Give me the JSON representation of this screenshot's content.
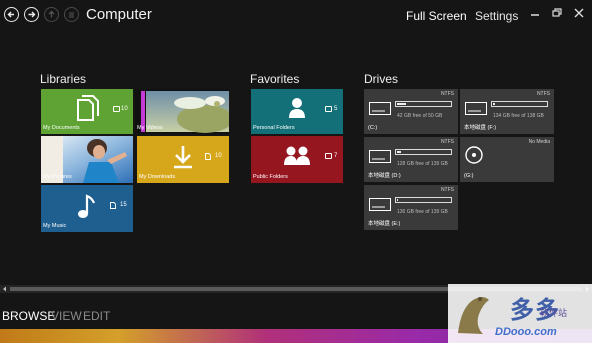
{
  "header": {
    "title": "Computer",
    "menu": [
      "Full Screen",
      "Settings"
    ]
  },
  "libraries": {
    "title": "Libraries",
    "tiles": [
      {
        "label": "My Documents",
        "count": "10",
        "color": "#5ea334",
        "icon": "documents-icon"
      },
      {
        "label": "My Videos",
        "icon": "video-thumbnail"
      },
      {
        "label": "My Pictures",
        "icon": "picture-thumbnail"
      },
      {
        "label": "My Downloads",
        "count": "10",
        "color": "#d6a71b",
        "icon": "download-icon"
      },
      {
        "label": "My Music",
        "count": "15",
        "color": "#1f5f8f",
        "icon": "music-note-icon"
      }
    ]
  },
  "favorites": {
    "title": "Favorites",
    "tiles": [
      {
        "label": "Personal Folders",
        "count": "5",
        "color": "#147078",
        "icon": "person-icon"
      },
      {
        "label": "Public Folders",
        "count": "7",
        "color": "#961620",
        "icon": "people-icon"
      }
    ]
  },
  "drives": {
    "title": "Drives",
    "items": [
      {
        "name": "(C:)",
        "fs": "NTFS",
        "usage": "42 GB free of 50 GB",
        "used_fraction": 0.16,
        "icon": "hard-drive-icon"
      },
      {
        "name": "本地磁盘 (F:)",
        "fs": "NTFS",
        "usage": "134 GB free of 138 GB",
        "used_fraction": 0.03,
        "icon": "hard-drive-icon"
      },
      {
        "name": "本地磁盘 (D:)",
        "fs": "NTFS",
        "usage": "128 GB free of 139 GB",
        "used_fraction": 0.08,
        "icon": "hard-drive-icon"
      },
      {
        "name": "(G:)",
        "fs": "No Media",
        "usage": "",
        "icon": "optical-drive-icon"
      },
      {
        "name": "本地磁盘 (E:)",
        "fs": "NTFS",
        "usage": "136 GB free of 139 GB",
        "used_fraction": 0.02,
        "icon": "hard-drive-icon"
      }
    ]
  },
  "bottom": {
    "tabs": [
      "BROWSE",
      "VIEW",
      "EDIT"
    ]
  },
  "watermark": {
    "main": "多多",
    "sub": "软件站",
    "domain": "DDooo.com"
  }
}
